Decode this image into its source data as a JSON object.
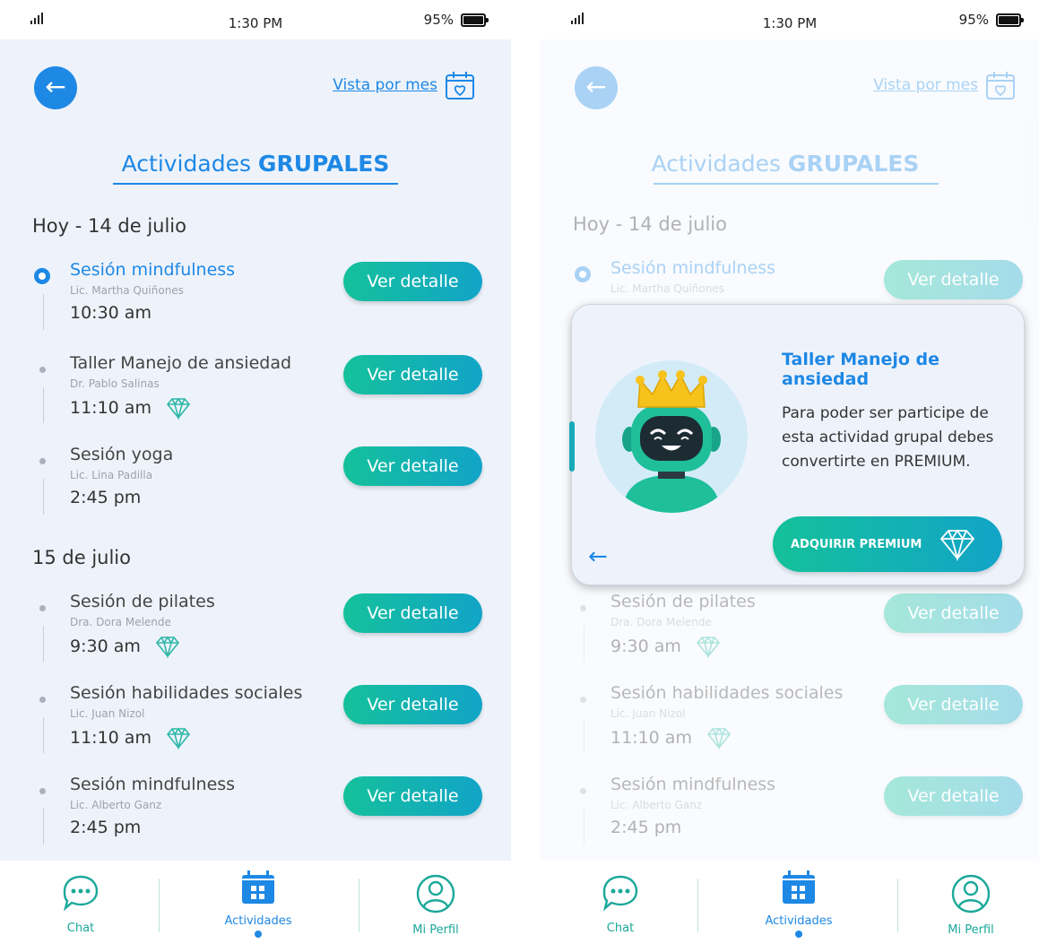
{
  "status_bar": {
    "time": "1:30 PM",
    "battery": "95%"
  },
  "header": {
    "month_view_label": "Vista por mes"
  },
  "page_title": {
    "regular": "Actividades ",
    "bold": "GRUPALES"
  },
  "days": [
    {
      "label": "Hoy - 14 de julio",
      "activities": [
        {
          "name": "Sesión mindfulness",
          "host": "Lic. Martha Quiñones",
          "time": "10:30 am",
          "premium": false,
          "active": true,
          "button": "Ver detalle"
        },
        {
          "name": "Taller Manejo de ansiedad",
          "host": "Dr. Pablo Salinas",
          "time": "11:10 am",
          "premium": true,
          "active": false,
          "button": "Ver detalle"
        },
        {
          "name": "Sesión yoga",
          "host": "Lic. Lina Padilla",
          "time": "2:45 pm",
          "premium": false,
          "active": false,
          "button": "Ver detalle"
        }
      ]
    },
    {
      "label": "15 de julio",
      "activities": [
        {
          "name": "Sesión de pilates",
          "host": "Dra. Dora Melende",
          "time": "9:30 am",
          "premium": true,
          "active": false,
          "button": "Ver detalle"
        },
        {
          "name": "Sesión habilidades sociales",
          "host": "Lic. Juan Nizol",
          "time": "11:10 am",
          "premium": true,
          "active": false,
          "button": "Ver detalle"
        },
        {
          "name": "Sesión mindfulness",
          "host": "Lic. Alberto Ganz",
          "time": "2:45 pm",
          "premium": false,
          "active": false,
          "button": "Ver detalle"
        }
      ]
    }
  ],
  "bottom_nav": [
    {
      "label": "Chat",
      "icon": "chat-bubble-icon"
    },
    {
      "label": "Actividades",
      "icon": "calendar-grid-icon",
      "active": true
    },
    {
      "label": "Mi Perfil",
      "icon": "user-profile-icon"
    }
  ],
  "modal": {
    "title": "Taller Manejo de ansiedad",
    "text": "Para poder ser participe de esta actividad grupal debes convertirte en PREMIUM.",
    "button": "ADQUIRIR PREMIUM",
    "illustration": "robot-with-crown"
  },
  "colors": {
    "primary_blue": "#1e88e5",
    "teal_start": "#14c19b",
    "teal_end": "#12a4c8",
    "bg": "#eef3fb"
  }
}
